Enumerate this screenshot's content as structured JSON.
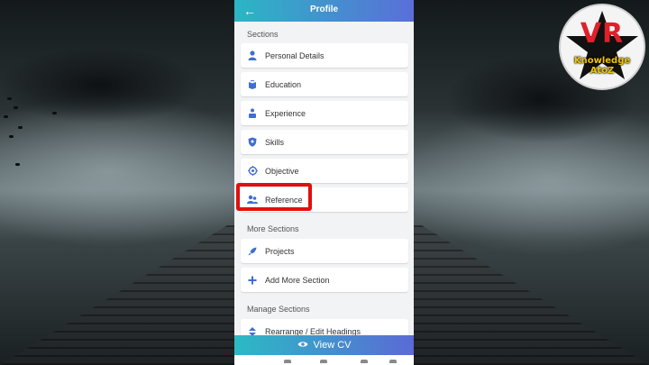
{
  "app": {
    "title": "Profile",
    "back_icon": "arrow-left-icon"
  },
  "sections": {
    "label": "Sections",
    "items": [
      {
        "label": "Personal Details",
        "icon": "person-icon"
      },
      {
        "label": "Education",
        "icon": "book-icon"
      },
      {
        "label": "Experience",
        "icon": "briefcase-person-icon"
      },
      {
        "label": "Skills",
        "icon": "shield-icon"
      },
      {
        "label": "Objective",
        "icon": "target-icon"
      },
      {
        "label": "Reference",
        "icon": "people-icon"
      }
    ]
  },
  "more_sections": {
    "label": "More Sections",
    "items": [
      {
        "label": "Projects",
        "icon": "rocket-icon"
      },
      {
        "label": "Add More Section",
        "icon": "plus-icon"
      }
    ]
  },
  "manage_sections": {
    "label": "Manage Sections",
    "items": [
      {
        "label": "Rearrange / Edit Headings",
        "icon": "sort-icon"
      }
    ]
  },
  "footer": {
    "view_cv_label": "View  CV",
    "eye_icon": "eye-icon"
  },
  "logo": {
    "title": "VR",
    "subtitle": "Knowledge AtoZ"
  },
  "colors": {
    "accent_start": "#2bb6c4",
    "accent_end": "#5a6fd8",
    "icon_blue": "#3f6fd0",
    "highlight": "#e01010"
  }
}
